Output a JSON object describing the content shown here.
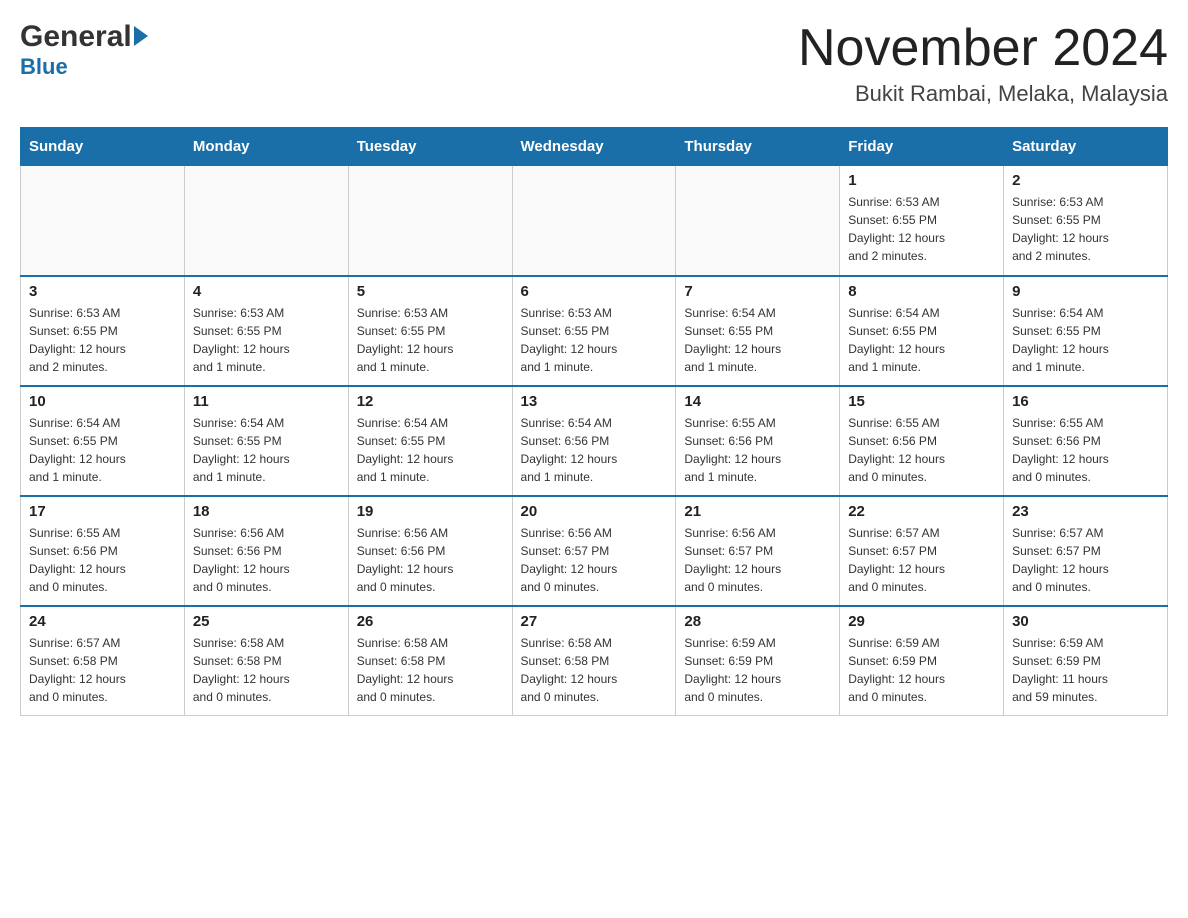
{
  "logo": {
    "general": "General",
    "blue": "Blue"
  },
  "title": {
    "month_year": "November 2024",
    "location": "Bukit Rambai, Melaka, Malaysia"
  },
  "weekdays": [
    "Sunday",
    "Monday",
    "Tuesday",
    "Wednesday",
    "Thursday",
    "Friday",
    "Saturday"
  ],
  "weeks": [
    {
      "days": [
        {
          "num": "",
          "info": ""
        },
        {
          "num": "",
          "info": ""
        },
        {
          "num": "",
          "info": ""
        },
        {
          "num": "",
          "info": ""
        },
        {
          "num": "",
          "info": ""
        },
        {
          "num": "1",
          "info": "Sunrise: 6:53 AM\nSunset: 6:55 PM\nDaylight: 12 hours\nand 2 minutes."
        },
        {
          "num": "2",
          "info": "Sunrise: 6:53 AM\nSunset: 6:55 PM\nDaylight: 12 hours\nand 2 minutes."
        }
      ]
    },
    {
      "days": [
        {
          "num": "3",
          "info": "Sunrise: 6:53 AM\nSunset: 6:55 PM\nDaylight: 12 hours\nand 2 minutes."
        },
        {
          "num": "4",
          "info": "Sunrise: 6:53 AM\nSunset: 6:55 PM\nDaylight: 12 hours\nand 1 minute."
        },
        {
          "num": "5",
          "info": "Sunrise: 6:53 AM\nSunset: 6:55 PM\nDaylight: 12 hours\nand 1 minute."
        },
        {
          "num": "6",
          "info": "Sunrise: 6:53 AM\nSunset: 6:55 PM\nDaylight: 12 hours\nand 1 minute."
        },
        {
          "num": "7",
          "info": "Sunrise: 6:54 AM\nSunset: 6:55 PM\nDaylight: 12 hours\nand 1 minute."
        },
        {
          "num": "8",
          "info": "Sunrise: 6:54 AM\nSunset: 6:55 PM\nDaylight: 12 hours\nand 1 minute."
        },
        {
          "num": "9",
          "info": "Sunrise: 6:54 AM\nSunset: 6:55 PM\nDaylight: 12 hours\nand 1 minute."
        }
      ]
    },
    {
      "days": [
        {
          "num": "10",
          "info": "Sunrise: 6:54 AM\nSunset: 6:55 PM\nDaylight: 12 hours\nand 1 minute."
        },
        {
          "num": "11",
          "info": "Sunrise: 6:54 AM\nSunset: 6:55 PM\nDaylight: 12 hours\nand 1 minute."
        },
        {
          "num": "12",
          "info": "Sunrise: 6:54 AM\nSunset: 6:55 PM\nDaylight: 12 hours\nand 1 minute."
        },
        {
          "num": "13",
          "info": "Sunrise: 6:54 AM\nSunset: 6:56 PM\nDaylight: 12 hours\nand 1 minute."
        },
        {
          "num": "14",
          "info": "Sunrise: 6:55 AM\nSunset: 6:56 PM\nDaylight: 12 hours\nand 1 minute."
        },
        {
          "num": "15",
          "info": "Sunrise: 6:55 AM\nSunset: 6:56 PM\nDaylight: 12 hours\nand 0 minutes."
        },
        {
          "num": "16",
          "info": "Sunrise: 6:55 AM\nSunset: 6:56 PM\nDaylight: 12 hours\nand 0 minutes."
        }
      ]
    },
    {
      "days": [
        {
          "num": "17",
          "info": "Sunrise: 6:55 AM\nSunset: 6:56 PM\nDaylight: 12 hours\nand 0 minutes."
        },
        {
          "num": "18",
          "info": "Sunrise: 6:56 AM\nSunset: 6:56 PM\nDaylight: 12 hours\nand 0 minutes."
        },
        {
          "num": "19",
          "info": "Sunrise: 6:56 AM\nSunset: 6:56 PM\nDaylight: 12 hours\nand 0 minutes."
        },
        {
          "num": "20",
          "info": "Sunrise: 6:56 AM\nSunset: 6:57 PM\nDaylight: 12 hours\nand 0 minutes."
        },
        {
          "num": "21",
          "info": "Sunrise: 6:56 AM\nSunset: 6:57 PM\nDaylight: 12 hours\nand 0 minutes."
        },
        {
          "num": "22",
          "info": "Sunrise: 6:57 AM\nSunset: 6:57 PM\nDaylight: 12 hours\nand 0 minutes."
        },
        {
          "num": "23",
          "info": "Sunrise: 6:57 AM\nSunset: 6:57 PM\nDaylight: 12 hours\nand 0 minutes."
        }
      ]
    },
    {
      "days": [
        {
          "num": "24",
          "info": "Sunrise: 6:57 AM\nSunset: 6:58 PM\nDaylight: 12 hours\nand 0 minutes."
        },
        {
          "num": "25",
          "info": "Sunrise: 6:58 AM\nSunset: 6:58 PM\nDaylight: 12 hours\nand 0 minutes."
        },
        {
          "num": "26",
          "info": "Sunrise: 6:58 AM\nSunset: 6:58 PM\nDaylight: 12 hours\nand 0 minutes."
        },
        {
          "num": "27",
          "info": "Sunrise: 6:58 AM\nSunset: 6:58 PM\nDaylight: 12 hours\nand 0 minutes."
        },
        {
          "num": "28",
          "info": "Sunrise: 6:59 AM\nSunset: 6:59 PM\nDaylight: 12 hours\nand 0 minutes."
        },
        {
          "num": "29",
          "info": "Sunrise: 6:59 AM\nSunset: 6:59 PM\nDaylight: 12 hours\nand 0 minutes."
        },
        {
          "num": "30",
          "info": "Sunrise: 6:59 AM\nSunset: 6:59 PM\nDaylight: 11 hours\nand 59 minutes."
        }
      ]
    }
  ]
}
